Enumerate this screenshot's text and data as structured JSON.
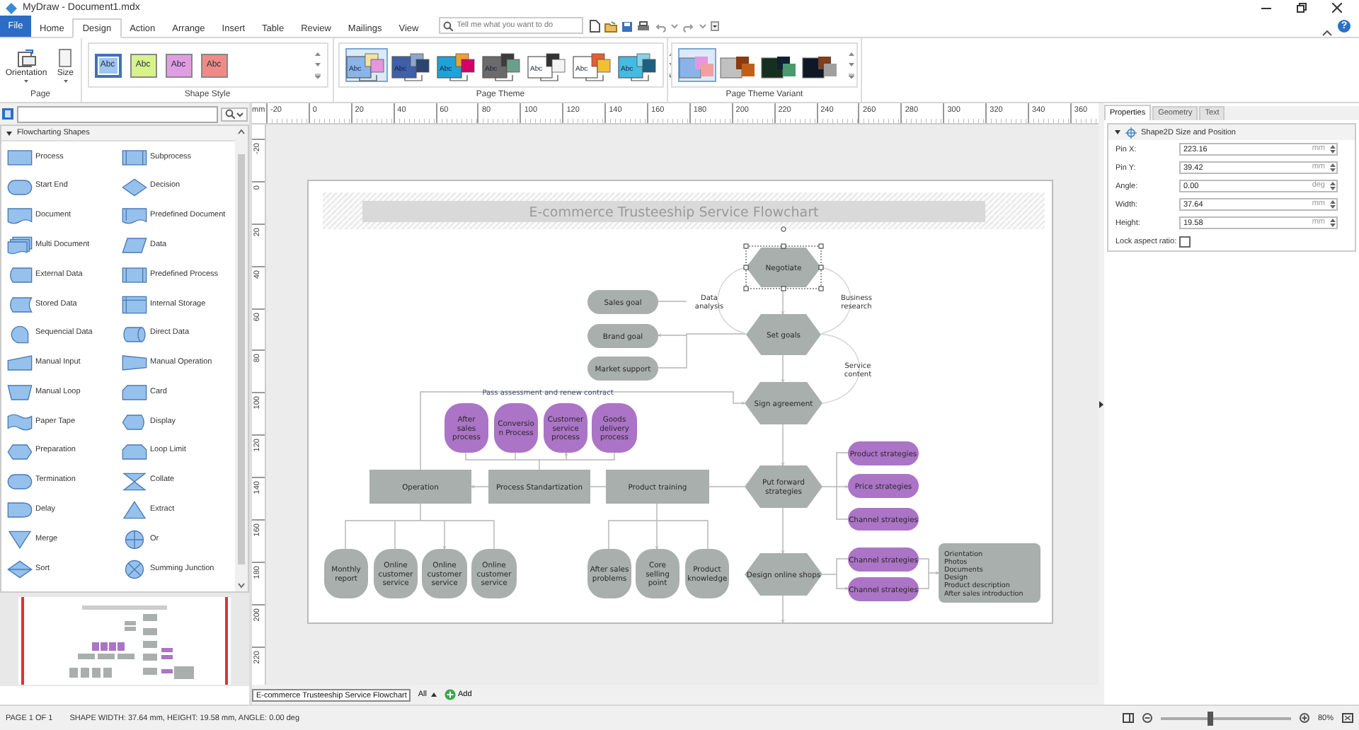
{
  "window": {
    "title": "MyDraw - Document1.mdx",
    "help": "?"
  },
  "menu": {
    "file": "File",
    "tabs": [
      {
        "label": "Home",
        "selected": false
      },
      {
        "label": "Design",
        "selected": true
      },
      {
        "label": "Action",
        "selected": false
      },
      {
        "label": "Arrange",
        "selected": false
      },
      {
        "label": "Insert",
        "selected": false
      },
      {
        "label": "Table",
        "selected": false
      },
      {
        "label": "Review",
        "selected": false
      },
      {
        "label": "Mailings",
        "selected": false
      },
      {
        "label": "View",
        "selected": false
      }
    ],
    "search": {
      "placeholder": "Tell me what you want to do"
    }
  },
  "ribbon": {
    "page": {
      "label": "Page",
      "buttons": [
        "Orientation",
        "Size"
      ]
    },
    "shape_style": {
      "label": "Shape Style",
      "items": [
        {
          "label": "Abc",
          "color": "#9ec6ee",
          "selected": true
        },
        {
          "label": "Abc",
          "color": "#d8f28c",
          "selected": false
        },
        {
          "label": "Abc",
          "color": "#e29de2",
          "selected": false
        },
        {
          "label": "Abc",
          "color": "#ef8b86",
          "selected": false
        }
      ]
    },
    "page_theme": {
      "label": "Page Theme",
      "items": [
        {
          "label": "Abc",
          "selected": true
        },
        {
          "label": "Abc",
          "selected": false
        },
        {
          "label": "Abc",
          "selected": false
        },
        {
          "label": "Abc",
          "selected": false
        },
        {
          "label": "Abc",
          "selected": false
        },
        {
          "label": "Abc",
          "selected": false
        },
        {
          "label": "Abc",
          "selected": false
        }
      ]
    },
    "page_theme_variant": {
      "label": "Page Theme Variant",
      "items": [
        {
          "selected": true
        },
        {
          "selected": false
        },
        {
          "selected": false
        },
        {
          "selected": false
        }
      ]
    }
  },
  "shapes_panel": {
    "section": {
      "title": "Flowcharting Shapes",
      "expanded": true
    },
    "items": [
      {
        "label": "Process"
      },
      {
        "label": "Subprocess"
      },
      {
        "label": "Start End"
      },
      {
        "label": "Decision"
      },
      {
        "label": "Document"
      },
      {
        "label": "Predefined Document"
      },
      {
        "label": "Multi Document"
      },
      {
        "label": "Data"
      },
      {
        "label": "External Data"
      },
      {
        "label": "Predefined Process"
      },
      {
        "label": "Stored Data"
      },
      {
        "label": "Internal Storage"
      },
      {
        "label": "Sequencial Data"
      },
      {
        "label": "Direct Data"
      },
      {
        "label": "Manual Input"
      },
      {
        "label": "Manual Operation"
      },
      {
        "label": "Manual Loop"
      },
      {
        "label": "Card"
      },
      {
        "label": "Paper Tape"
      },
      {
        "label": "Display"
      },
      {
        "label": "Preparation"
      },
      {
        "label": "Loop Limit"
      },
      {
        "label": "Termination"
      },
      {
        "label": "Collate"
      },
      {
        "label": "Delay"
      },
      {
        "label": "Extract"
      },
      {
        "label": "Merge"
      },
      {
        "label": "Or"
      },
      {
        "label": "Sort"
      },
      {
        "label": "Summing Junction"
      }
    ]
  },
  "rulers": {
    "unit": "mm",
    "horizontal": [
      "-20",
      "0",
      "20",
      "40",
      "60",
      "80",
      "100",
      "120",
      "140",
      "160",
      "180",
      "200",
      "220",
      "240",
      "260",
      "280",
      "300",
      "320",
      "340",
      "360"
    ],
    "vertical": [
      "-20",
      "0",
      "20",
      "40",
      "60",
      "80",
      "100",
      "120",
      "140",
      "160",
      "180",
      "200",
      "220"
    ]
  },
  "diagram": {
    "title": "E-commerce Trusteeship Service Flowchart",
    "nodes": [
      {
        "kind": "hexagon",
        "lines": [
          "Negotiate"
        ],
        "color": "#a8afac",
        "selected": true
      },
      {
        "kind": "pill",
        "lines": [
          "Sales goal"
        ],
        "color": "#a8afac",
        "selected": false
      },
      {
        "kind": "pill",
        "lines": [
          "Brand goal"
        ],
        "color": "#a8afac",
        "selected": false
      },
      {
        "kind": "pill",
        "lines": [
          "Market support"
        ],
        "color": "#a8afac",
        "selected": false
      },
      {
        "kind": "hexagon",
        "lines": [
          "Set goals"
        ],
        "color": "#a8afac",
        "selected": false
      },
      {
        "kind": "hexagon",
        "lines": [
          "Sign agreement"
        ],
        "color": "#a8afac",
        "selected": false
      },
      {
        "kind": "rounded",
        "lines": [
          "After",
          "sales",
          "process"
        ],
        "color": "#ab74c6",
        "selected": false
      },
      {
        "kind": "rounded",
        "lines": [
          "Conversio",
          "n Process"
        ],
        "color": "#ab74c6",
        "selected": false
      },
      {
        "kind": "rounded",
        "lines": [
          "Customer",
          "service",
          "process"
        ],
        "color": "#ab74c6",
        "selected": false
      },
      {
        "kind": "rounded",
        "lines": [
          "Goods",
          "delivery",
          "process"
        ],
        "color": "#ab74c6",
        "selected": false
      },
      {
        "kind": "pill",
        "lines": [
          "Product strategies"
        ],
        "color": "#ab74c6",
        "selected": false
      },
      {
        "kind": "rect",
        "lines": [
          "Operation"
        ],
        "color": "#a8afac",
        "selected": false
      },
      {
        "kind": "rect",
        "lines": [
          "Process Standartization"
        ],
        "color": "#a8afac",
        "selected": false
      },
      {
        "kind": "rect",
        "lines": [
          "Product training"
        ],
        "color": "#a8afac",
        "selected": false
      },
      {
        "kind": "hexagon",
        "lines": [
          "Put forward",
          "strategies"
        ],
        "color": "#a8afac",
        "selected": false
      },
      {
        "kind": "pill",
        "lines": [
          "Price strategies"
        ],
        "color": "#ab74c6",
        "selected": false
      },
      {
        "kind": "pill",
        "lines": [
          "Channel strategies"
        ],
        "color": "#ab74c6",
        "selected": false
      },
      {
        "kind": "rounded",
        "lines": [
          "Monthly",
          "report"
        ],
        "color": "#a8afac",
        "selected": false
      },
      {
        "kind": "rounded",
        "lines": [
          "Online",
          "customer",
          "service"
        ],
        "color": "#a8afac",
        "selected": false
      },
      {
        "kind": "rounded",
        "lines": [
          "Online",
          "customer",
          "service"
        ],
        "color": "#a8afac",
        "selected": false
      },
      {
        "kind": "rounded",
        "lines": [
          "Online",
          "customer",
          "service"
        ],
        "color": "#a8afac",
        "selected": false
      },
      {
        "kind": "rounded",
        "lines": [
          "After sales",
          "problems"
        ],
        "color": "#a8afac",
        "selected": false
      },
      {
        "kind": "rounded",
        "lines": [
          "Core",
          "selling",
          "point"
        ],
        "color": "#a8afac",
        "selected": false
      },
      {
        "kind": "rounded",
        "lines": [
          "Product",
          "knowledge"
        ],
        "color": "#a8afac",
        "selected": false
      },
      {
        "kind": "hexagon",
        "lines": [
          "Design online shops"
        ],
        "color": "#a8afac",
        "selected": false
      },
      {
        "kind": "pill",
        "lines": [
          "Channel strategies"
        ],
        "color": "#ab74c6",
        "selected": false
      },
      {
        "kind": "pill",
        "lines": [
          "Channel strategies"
        ],
        "color": "#ab74c6",
        "selected": false
      },
      {
        "kind": "note",
        "lines": [
          "Orientation",
          "Photos",
          "Documents",
          "Design",
          "Product description",
          "After sales introduction"
        ],
        "color": "#a8afac",
        "selected": false
      }
    ],
    "labels": [
      {
        "lines": [
          "Data",
          "analysis"
        ]
      },
      {
        "lines": [
          "Business",
          "research"
        ]
      },
      {
        "lines": [
          "Service",
          "content"
        ]
      },
      {
        "lines": [
          "Pass assessment and renew contract"
        ]
      }
    ]
  },
  "properties": {
    "tabs": [
      {
        "label": "Properties",
        "selected": true
      },
      {
        "label": "Geometry",
        "selected": false
      },
      {
        "label": "Text",
        "selected": false
      }
    ],
    "section": {
      "title": "Shape2D Size and Position",
      "expanded": true
    },
    "fields": [
      {
        "label": "Pin X:",
        "value": "223.16",
        "unit": "mm"
      },
      {
        "label": "Pin Y:",
        "value": "39.42",
        "unit": "mm"
      },
      {
        "label": "Angle:",
        "value": "0.00",
        "unit": "deg"
      },
      {
        "label": "Width:",
        "value": "37.64",
        "unit": "mm"
      },
      {
        "label": "Height:",
        "value": "19.58",
        "unit": "mm"
      }
    ],
    "lock_aspect_ratio": {
      "label": "Lock aspect ratio:",
      "checked": false
    }
  },
  "page_tabs": {
    "tabs": [
      {
        "label": "E-commerce Trusteeship Service Flowchart",
        "selected": true
      }
    ],
    "all": "All",
    "add": "Add"
  },
  "status_bar": {
    "page": "PAGE 1 OF 1",
    "shape": "SHAPE WIDTH: 37.64 mm, HEIGHT: 19.58 mm, ANGLE: 0.00 deg",
    "zoom": {
      "level": 0.38,
      "label": "80%"
    }
  }
}
